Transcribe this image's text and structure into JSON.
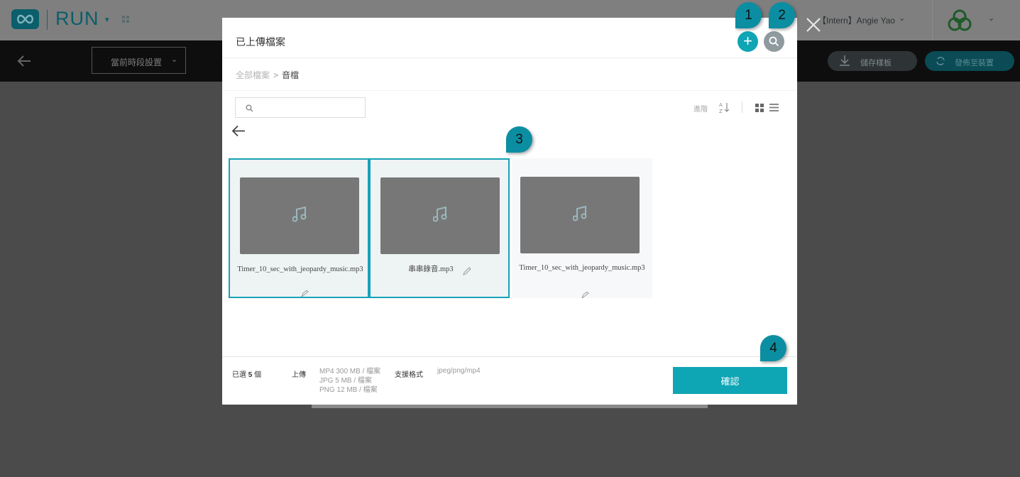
{
  "app": {
    "logo_text": "RUN",
    "user_name": "【Intern】Angie Yao",
    "stage_select": "當前時段設置",
    "save_template": "儲存樣板",
    "publish": "發佈至裝置"
  },
  "modal": {
    "title": "已上傳檔案",
    "breadcrumb": {
      "root": "全部檔案",
      "separator": ">",
      "current": "音檔"
    },
    "search": {
      "value": "",
      "placeholder": ""
    },
    "sort_label": "進階",
    "files": [
      {
        "name": "Timer_10_sec_with_jeopardy_music.mp3",
        "selected": true
      },
      {
        "name": "串串錄音.mp3",
        "selected": true
      },
      {
        "name": "Timer_10_sec_with_jeopardy_music.mp3",
        "selected": false
      }
    ],
    "footer": {
      "selected_prefix": "已選",
      "selected_count": "5",
      "selected_suffix": "個",
      "upload_label": "上傳",
      "limits": [
        "MP4 300 MB / 檔案",
        "JPG 5 MB / 檔案",
        "PNG 12 MB / 檔案"
      ],
      "formats_label": "支援格式",
      "formats": "jpeg/png/mp4",
      "confirm": "確認"
    }
  },
  "callouts": [
    "1",
    "2",
    "3",
    "4"
  ],
  "icons": {
    "add": "plus-icon",
    "search": "search-icon",
    "close": "close-icon",
    "back": "arrow-left-icon",
    "file_type": "music-note-icon"
  },
  "colors": {
    "accent": "#0ea5b5",
    "callout": "#0b8ea2",
    "selected_border": "#17a2b8"
  }
}
